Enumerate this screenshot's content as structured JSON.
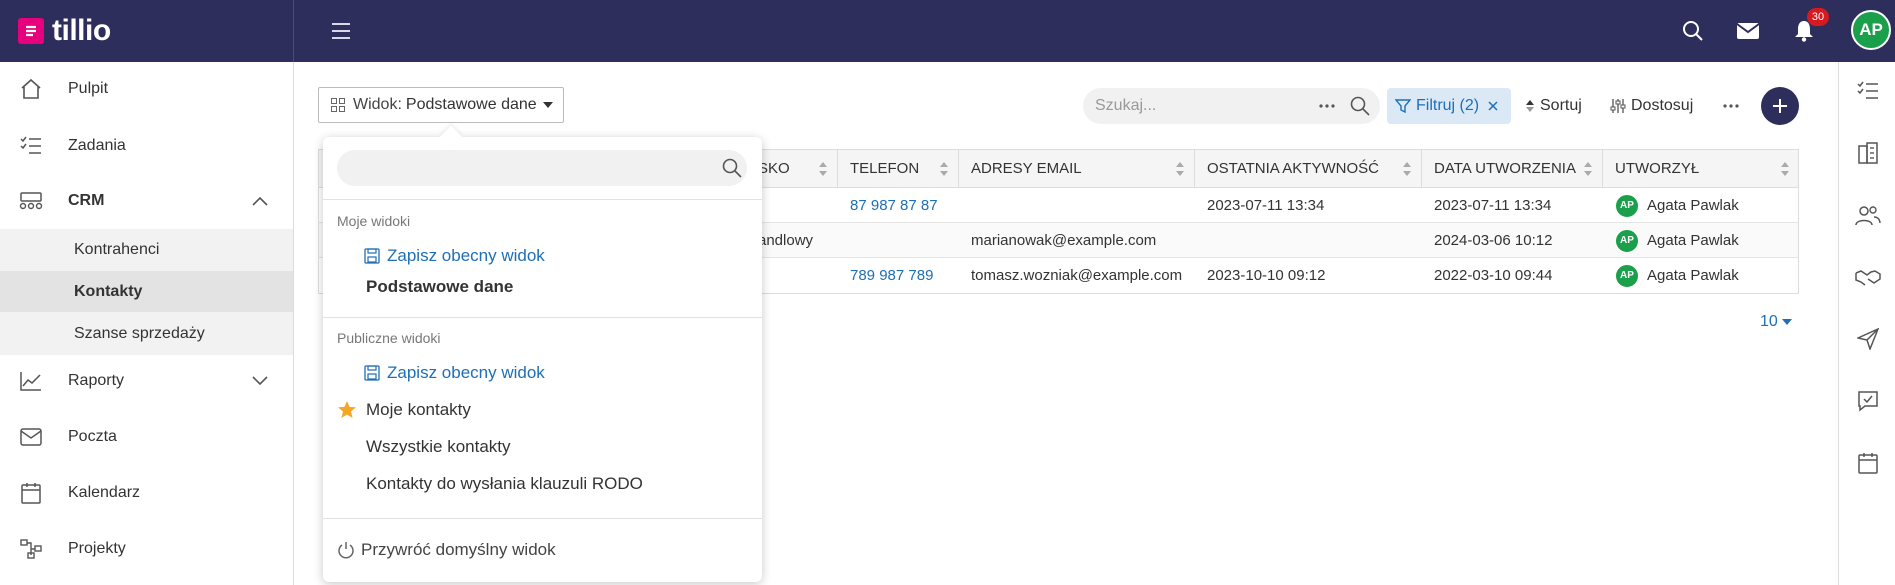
{
  "brand": {
    "name": "tillio"
  },
  "topbar": {
    "notifications_count": "30",
    "user_initials": "AP"
  },
  "sidebar": {
    "items": [
      {
        "label": "Pulpit",
        "icon": "home-icon"
      },
      {
        "label": "Zadania",
        "icon": "tasks-icon"
      },
      {
        "label": "CRM",
        "icon": "crm-icon",
        "expanded": true
      },
      {
        "label": "Raporty",
        "icon": "chart-icon"
      },
      {
        "label": "Poczta",
        "icon": "mail-icon"
      },
      {
        "label": "Kalendarz",
        "icon": "calendar-icon"
      },
      {
        "label": "Projekty",
        "icon": "projects-icon"
      }
    ],
    "crm_sub": [
      {
        "label": "Kontrahenci"
      },
      {
        "label": "Kontakty",
        "active": true
      },
      {
        "label": "Szanse sprzedaży"
      }
    ]
  },
  "toolbar": {
    "view_prefix": "Widok:",
    "view_value": "Podstawowe dane",
    "search_placeholder": "Szukaj...",
    "filter_label": "Filtruj (2)",
    "sort_label": "Sortuj",
    "customize_label": "Dostosuj"
  },
  "table": {
    "columns": [
      "SKO",
      "TELEFON",
      "ADRESY EMAIL",
      "OSTATNIA AKTYWNOŚĆ",
      "DATA UTWORZENIA",
      "UTWORZYŁ"
    ],
    "rows": [
      {
        "position": "",
        "phone": "87 987 87 87",
        "email": "",
        "last_activity": "2023-07-11 13:34",
        "created": "2023-07-11 13:34",
        "creator_initials": "AP",
        "creator": "Agata Pawlak"
      },
      {
        "position": "andlowy",
        "phone": "",
        "email": "marianowak@example.com",
        "last_activity": "",
        "created": "2024-03-06 10:12",
        "creator_initials": "AP",
        "creator": "Agata Pawlak"
      },
      {
        "position": "",
        "phone": "789 987 789",
        "email": "tomasz.wozniak@example.com",
        "last_activity": "2023-10-10 09:12",
        "created": "2022-03-10 09:44",
        "creator_initials": "AP",
        "creator": "Agata Pawlak"
      }
    ],
    "page_size": "10"
  },
  "dropdown": {
    "my_views_heading": "Moje widoki",
    "my_views": {
      "save_label": "Zapisz obecny widok",
      "items": [
        "Podstawowe dane"
      ]
    },
    "public_views_heading": "Publiczne widoki",
    "public_views": {
      "save_label": "Zapisz obecny widok",
      "items": [
        "Moje kontakty",
        "Wszystkie kontakty",
        "Kontakty do wysłania klauzuli RODO"
      ]
    },
    "reset_label": "Przywróć domyślny widok"
  },
  "colors": {
    "topbar": "#2e2e5c",
    "brand_pink": "#e6007e",
    "link_blue": "#1e6fb5",
    "avatar_green": "#1aa04a",
    "badge_red": "#d71920",
    "star": "#f5a623"
  }
}
